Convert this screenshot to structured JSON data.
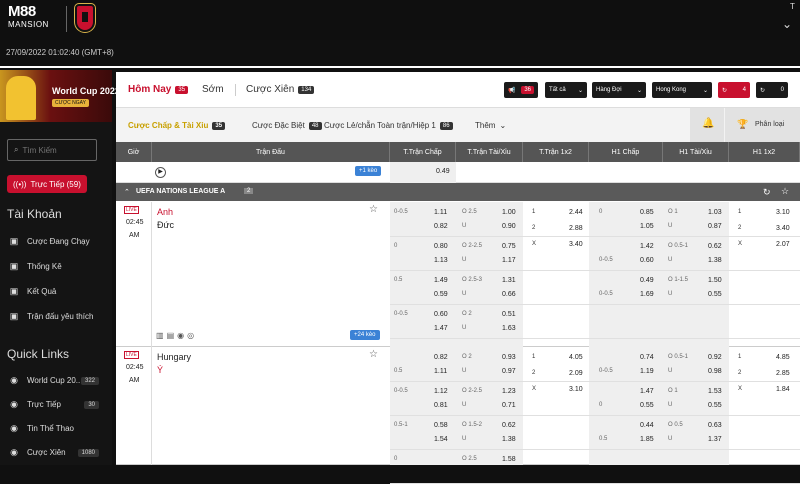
{
  "header": {
    "logo_top": "M88",
    "logo_bottom": "MANSION",
    "right_letter": "T",
    "datetime": "27/09/2022 01:02:40 (GMT+8)"
  },
  "sidebar": {
    "banner_title": "World Cup 2022",
    "banner_button": "CƯỢC NGAY",
    "search_placeholder": "Tìm Kiếm",
    "live_button": "Trực Tiếp (59)",
    "account_heading": "Tài Khoản",
    "account_items": [
      {
        "label": "Cược Đang Chạy",
        "icon": "ticket-icon"
      },
      {
        "label": "Thống Kê",
        "icon": "chart-icon"
      },
      {
        "label": "Kết Quả",
        "icon": "result-icon"
      },
      {
        "label": "Trận đấu yêu thích",
        "icon": "star-icon"
      }
    ],
    "quick_heading": "Quick Links",
    "quick_items": [
      {
        "label": "World Cup 20...",
        "count": "322",
        "icon": "trophy-icon"
      },
      {
        "label": "Trực Tiếp",
        "count": "30",
        "icon": "play-icon"
      },
      {
        "label": "Tin Thể Thao",
        "count": "",
        "icon": "news-icon"
      },
      {
        "label": "Cược Xiên",
        "count": "1080",
        "icon": "parlay-icon"
      }
    ]
  },
  "tabs": {
    "today": "Hôm Nay",
    "today_count": "35",
    "early": "Sớm",
    "parlay": "Cược Xiên",
    "parlay_count": "134",
    "announce_count": "36",
    "filter_all": "Tất cả",
    "filter_team": "Hàng Đợi",
    "filter_odds": "Hong Kong",
    "refresh_count": "4",
    "check_count": "0"
  },
  "subtabs": {
    "handicap": "Cược Chấp & Tài Xỉu",
    "handicap_count": "35",
    "special": "Cược Đặc Biệt",
    "special_count": "48",
    "outright": "Cược Lẻ/chẵn Toàn trận/Hiệp 1",
    "outright_count": "86",
    "more": "Thêm",
    "sort": "Phân loại"
  },
  "columns": [
    "Giờ",
    "Trận Đấu",
    "T.Trận Chấp",
    "T.Trận Tài/Xỉu",
    "T.Trận 1x2",
    "H1 Chấp",
    "H1 Tài/Xỉu",
    "H1 1x2"
  ],
  "row0": {
    "more": "+1 kèo",
    "value": "0.49"
  },
  "league": "UEFA NATIONS LEAGUE A",
  "league_count": "2",
  "match1": {
    "status": "LIVE",
    "time": "02:45",
    "ampm": "AM",
    "home": "Anh",
    "away": "Đức",
    "more": "+24 kèo",
    "lines": [
      {
        "hl": "0-0.5",
        "hh": "1.11",
        "ha": "0.82",
        "oul": "O 2.5",
        "ouo": "1.00",
        "ouu": "0.90",
        "uo": "U",
        "h1l": "0",
        "h1h": "0.85",
        "h1a": "1.05",
        "h1oul": "O 1",
        "h1o": "1.03",
        "h1u": "0.87"
      },
      {
        "hl": "0",
        "hh": "0.80",
        "ha": "1.13",
        "oul": "O 2-2.5",
        "ouo": "0.75",
        "ouu": "1.17",
        "uo": "U",
        "h1l": "0-0.5",
        "h1h": "1.42",
        "h1a": "0.60",
        "h1oul": "O 0.5-1",
        "h1o": "0.62",
        "h1u": "1.38"
      },
      {
        "hl": "0.5",
        "hh": "1.49",
        "ha": "0.59",
        "oul": "O 2.5-3",
        "ouo": "1.31",
        "ouu": "0.66",
        "uo": "U",
        "h1l": "0-0.5",
        "h1h": "0.49",
        "h1a": "1.69",
        "h1oul": "O 1-1.5",
        "h1o": "1.50",
        "h1u": "0.55"
      },
      {
        "hl": "0-0.5",
        "hh": "0.60",
        "ha": "1.47",
        "oul": "O 2",
        "ouo": "0.51",
        "ouu": "1.63",
        "uo": "U"
      }
    ],
    "x12": [
      {
        "k": "1",
        "v": "2.44"
      },
      {
        "k": "2",
        "v": "2.88"
      },
      {
        "k": "X",
        "v": "3.40"
      }
    ],
    "h1x12": [
      {
        "k": "1",
        "v": "3.10"
      },
      {
        "k": "2",
        "v": "3.40"
      },
      {
        "k": "X",
        "v": "2.07"
      }
    ]
  },
  "match2": {
    "status": "LIVE",
    "time": "02:45",
    "ampm": "AM",
    "home": "Hungary",
    "away": "Ý",
    "lines": [
      {
        "hl": "",
        "hh": "0.82",
        "ha": "1.11",
        "hl2": "0.5",
        "oul": "O 2",
        "ouo": "0.93",
        "ouu": "0.97",
        "uo": "U",
        "h1l": "0-0.5",
        "h1h": "0.74",
        "h1a": "1.19",
        "h1oul": "O 0.5-1",
        "h1o": "0.92",
        "h1u": "0.98"
      },
      {
        "hl": "0-0.5",
        "hh": "1.12",
        "ha": "0.81",
        "oul": "O 2-2.5",
        "ouo": "1.23",
        "ouu": "0.71",
        "uo": "U",
        "h1l": "0",
        "h1h": "1.47",
        "h1a": "0.55",
        "h1oul": "O 1",
        "h1o": "1.53",
        "h1u": "0.55"
      },
      {
        "hl": "0.5-1",
        "hh": "0.58",
        "ha": "1.54",
        "oul": "O 1.5-2",
        "ouo": "0.62",
        "ouu": "1.38",
        "uo": "U",
        "h1l": "0.5",
        "h1h": "0.44",
        "h1a": "1.85",
        "h1oul": "O 0.5",
        "h1o": "0.63",
        "h1u": "1.37"
      },
      {
        "hl": "0",
        "oul": "O 2.5",
        "ouo": "1.58"
      }
    ],
    "x12": [
      {
        "k": "1",
        "v": "4.05"
      },
      {
        "k": "2",
        "v": "2.09"
      },
      {
        "k": "X",
        "v": "3.10"
      }
    ],
    "h1x12": [
      {
        "k": "1",
        "v": "4.85"
      },
      {
        "k": "2",
        "v": "2.85"
      },
      {
        "k": "X",
        "v": "1.84"
      }
    ]
  }
}
